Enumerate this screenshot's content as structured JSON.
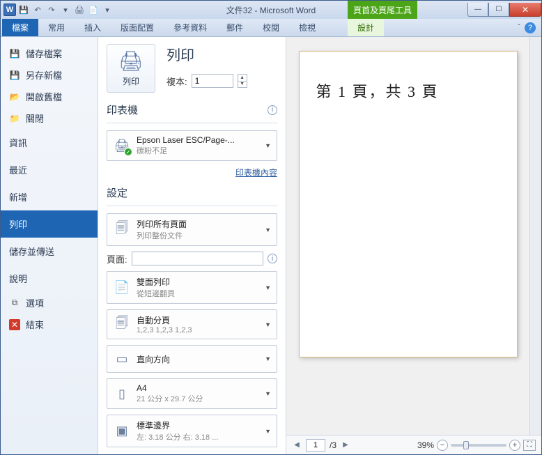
{
  "titlebar": {
    "title": "文件32 - Microsoft Word",
    "context_tool": "頁首及頁尾工具"
  },
  "ribbon": {
    "tabs": {
      "file": "檔案",
      "home": "常用",
      "insert": "插入",
      "layout": "版面配置",
      "references": "參考資料",
      "mailings": "郵件",
      "review": "校閱",
      "view": "檢視",
      "design": "設計"
    }
  },
  "leftnav": {
    "save": "儲存檔案",
    "saveas": "另存新檔",
    "open": "開啟舊檔",
    "close": "關閉",
    "info": "資訊",
    "recent": "最近",
    "new": "新增",
    "print": "列印",
    "share": "儲存並傳送",
    "help": "說明",
    "options": "選項",
    "exit": "結束"
  },
  "print": {
    "title": "列印",
    "button_label": "列印",
    "copies_label": "複本:",
    "copies_value": "1",
    "printer_section": "印表機",
    "printer_name": "Epson Laser ESC/Page-...",
    "printer_status": "碳粉不足",
    "printer_props": "印表機內容",
    "settings_section": "設定",
    "scope_title": "列印所有頁面",
    "scope_sub": "列印整份文件",
    "pages_label": "頁面:",
    "pages_value": "",
    "duplex_title": "雙面列印",
    "duplex_sub": "從短邊翻頁",
    "collate_title": "自動分頁",
    "collate_sub": "1,2,3   1,2,3   1,2,3",
    "orient_title": "直向方向",
    "paper_title": "A4",
    "paper_sub": "21 公分 x 29.7 公分",
    "margin_title": "標準邊界",
    "margin_sub": "左: 3.18 公分   右: 3.18 ..."
  },
  "preview": {
    "page_text": "第 1 頁，共 3 頁",
    "current_page": "1",
    "total_pages": "/3",
    "zoom": "39%"
  }
}
